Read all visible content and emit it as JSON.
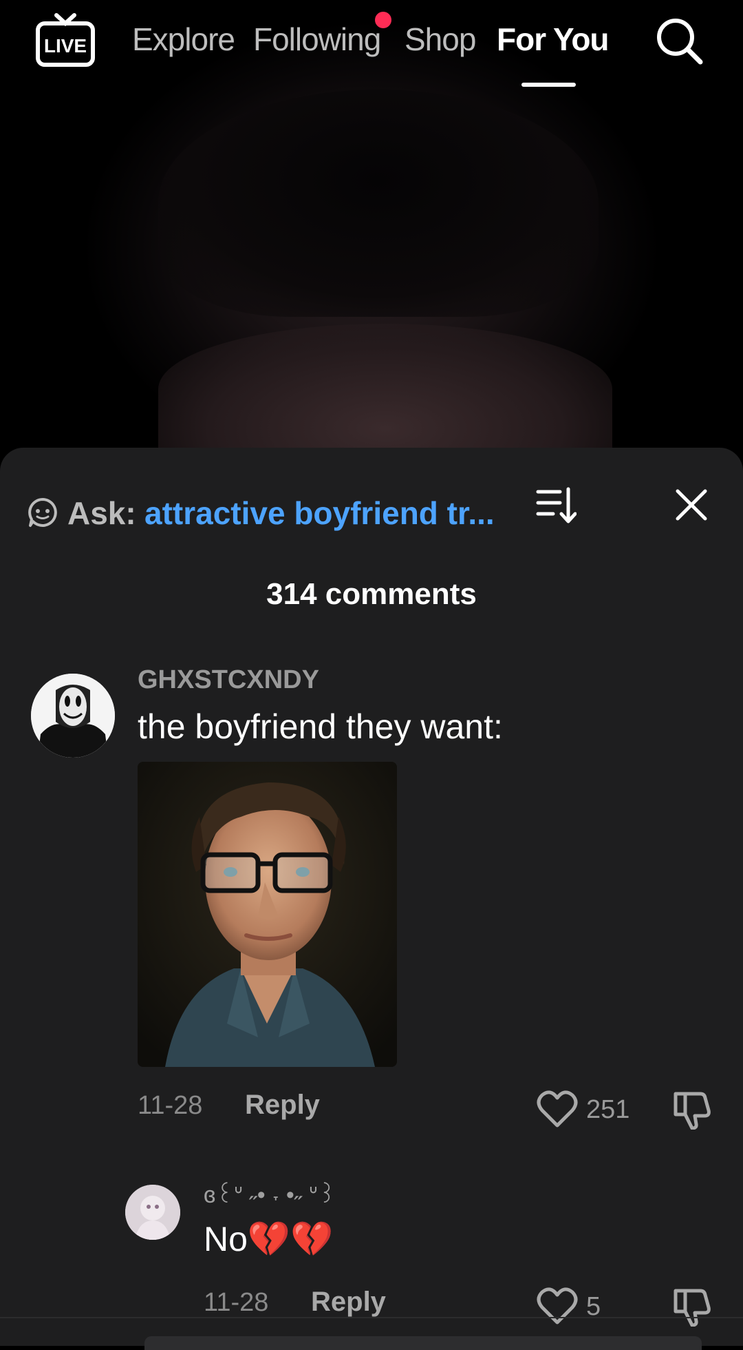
{
  "nav": {
    "live_label": "LIVE",
    "tabs": [
      "Explore",
      "Following",
      "Shop",
      "For You"
    ],
    "active_tab": "For You"
  },
  "sheet": {
    "ask_label": "Ask:",
    "ask_query": "attractive boyfriend tr...",
    "comment_count": "314 comments"
  },
  "comments": [
    {
      "username": "GHXSTCXNDY",
      "text": "the boyfriend they want:",
      "date": "11-28",
      "reply_label": "Reply",
      "likes": "251"
    },
    {
      "username": "ɞ꒰ᐡ ˶• ˕ •˶ ᐡ꒱",
      "text": "No💔💔",
      "date": "11-28",
      "reply_label": "Reply",
      "likes": "5"
    }
  ],
  "colors": {
    "accent": "#4da3ff",
    "notification": "#fe2c55",
    "sheet_bg": "#1e1e1f"
  }
}
